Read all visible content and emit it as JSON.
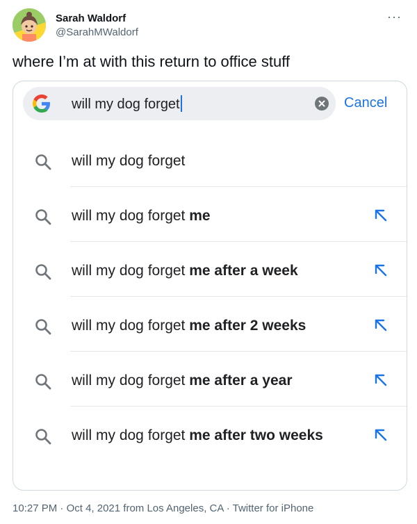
{
  "tweet": {
    "author_name": "Sarah Waldorf",
    "author_handle": "@SarahMWaldorf",
    "more_icon": "more-icon",
    "text": "where I’m at with this return to office stuff",
    "time": "10:27 PM",
    "date": "Oct 4, 2021",
    "location": "from Los Angeles, CA",
    "source": "Twitter for iPhone",
    "separator": "·"
  },
  "search": {
    "query": "will my dog forget",
    "cancel_label": "Cancel",
    "logo_icon": "google-logo-icon",
    "clear_icon": "clear-icon"
  },
  "suggestions": [
    {
      "prefix": "will my dog forget",
      "completion": "",
      "has_fill_arrow": false
    },
    {
      "prefix": "will my dog forget ",
      "completion": "me",
      "has_fill_arrow": true
    },
    {
      "prefix": "will my dog forget ",
      "completion": "me after a week",
      "has_fill_arrow": true
    },
    {
      "prefix": "will my dog forget ",
      "completion": "me after 2 weeks",
      "has_fill_arrow": true
    },
    {
      "prefix": "will my dog forget ",
      "completion": "me after a year",
      "has_fill_arrow": true
    },
    {
      "prefix": "will my dog forget ",
      "completion": "me after two weeks",
      "has_fill_arrow": true
    }
  ],
  "colors": {
    "accent": "#1a73e8",
    "text_primary": "#0f1419",
    "text_secondary": "#536471",
    "search_bg": "#eceef1"
  }
}
